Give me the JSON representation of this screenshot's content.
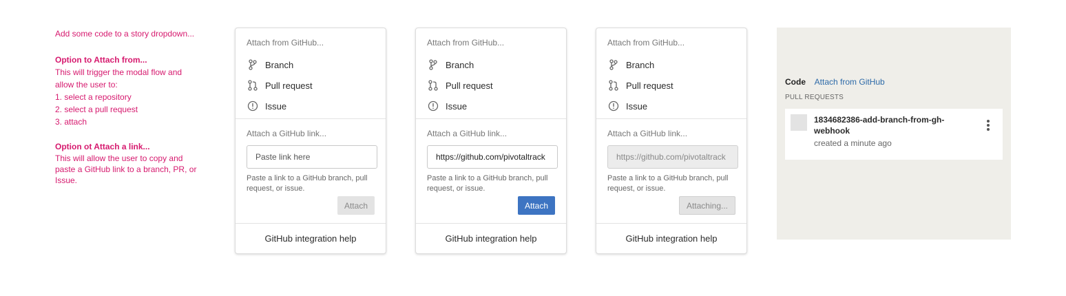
{
  "notes": {
    "intro": "Add some code to a story dropdown...",
    "attach_from_heading": "Option to Attach from...",
    "attach_from_lines": [
      "This will trigger the modal flow and",
      "allow the user to:",
      "1. select a repository",
      "2. select a pull request",
      "3. attach"
    ],
    "attach_link_heading": "Option ot Attach a link...",
    "attach_link_lines": [
      "This will allow the user to copy and",
      "paste a GitHub link to a branch, PR, or",
      "Issue."
    ]
  },
  "panels": [
    {
      "heading": "Attach from GitHub...",
      "options": [
        "Branch",
        "Pull request",
        "Issue"
      ],
      "link_heading": "Attach a GitHub link...",
      "input_value": "",
      "input_placeholder": "Paste link here",
      "hint": "Paste a link to a GitHub branch, pull request, or issue.",
      "button": "Attach",
      "help": "GitHub integration help"
    },
    {
      "heading": "Attach from GitHub...",
      "options": [
        "Branch",
        "Pull request",
        "Issue"
      ],
      "link_heading": "Attach a GitHub link...",
      "input_value": "https://github.com/pivotaltrack",
      "input_placeholder": "Paste link here",
      "hint": "Paste a link to a GitHub branch, pull request, or issue.",
      "button": "Attach",
      "help": "GitHub integration help"
    },
    {
      "heading": "Attach from GitHub...",
      "options": [
        "Branch",
        "Pull request",
        "Issue"
      ],
      "link_heading": "Attach a GitHub link...",
      "input_value": "https://github.com/pivotaltrack",
      "input_placeholder": "Paste link here",
      "hint": "Paste a link to a GitHub branch, pull request, or issue.",
      "button": "Attaching...",
      "help": "GitHub integration help"
    }
  ],
  "story_code": {
    "label": "Code",
    "link": "Attach from GitHub",
    "section": "PULL REQUESTS",
    "pr_title": "1834682386-add-branch-from-gh-webhook",
    "pr_meta": "created a minute ago"
  },
  "icons": {
    "branch": "branch-icon",
    "pull_request": "pull-request-icon",
    "issue": "issue-icon",
    "more": "kebab-menu-icon"
  },
  "colors": {
    "annotation": "#d6196e",
    "primary_button": "#3d74c2",
    "link": "#2d6aa8",
    "story_bg": "#efeee9"
  }
}
